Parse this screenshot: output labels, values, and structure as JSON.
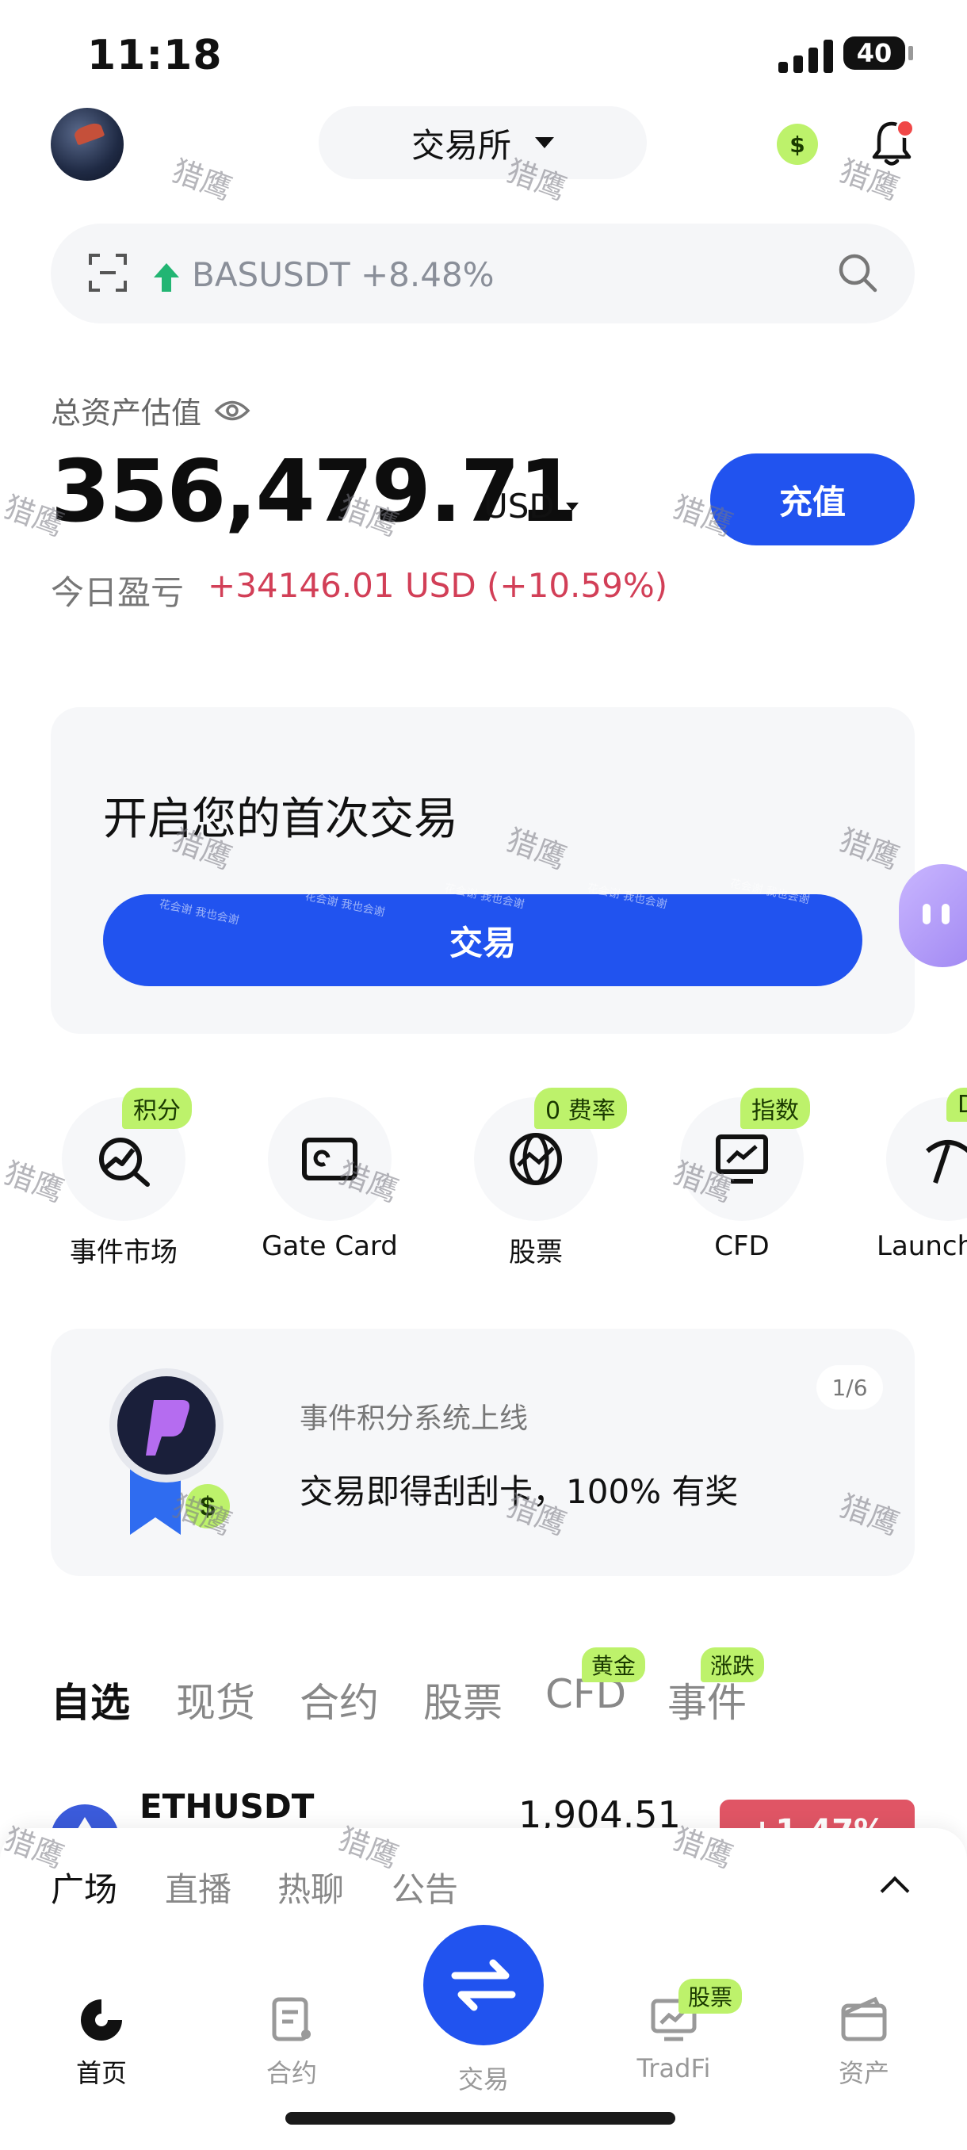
{
  "status_bar": {
    "time": "11:18",
    "battery": "40"
  },
  "header": {
    "exchange_label": "交易所"
  },
  "search": {
    "ticker_text": "BASUSDT +8.48%"
  },
  "balance": {
    "label": "总资产估值",
    "value": "356,479.71",
    "currency": "USD",
    "deposit_label": "充值",
    "pnl_label": "今日盈亏",
    "pnl_value": "+34146.01 USD (+10.59%)"
  },
  "first_trade": {
    "title": "开启您的首次交易",
    "button_label": "交易"
  },
  "shortcuts": [
    {
      "label": "事件市场",
      "badge": "积分",
      "icon": "chart-search-icon"
    },
    {
      "label": "Gate Card",
      "badge": "",
      "icon": "card-icon"
    },
    {
      "label": "股票",
      "badge": "0 费率",
      "icon": "globe-icon"
    },
    {
      "label": "CFD",
      "badge": "指数",
      "icon": "monitor-chart-icon"
    },
    {
      "label": "Launch",
      "badge": "D",
      "icon": "pickaxe-icon"
    }
  ],
  "promo": {
    "subtitle": "事件积分系统上线",
    "title": "交易即得刮刮卡，100% 有奖",
    "page": "1/6"
  },
  "market_tabs": [
    {
      "label": "自选",
      "active": true,
      "badge": ""
    },
    {
      "label": "现货",
      "active": false,
      "badge": ""
    },
    {
      "label": "合约",
      "active": false,
      "badge": ""
    },
    {
      "label": "股票",
      "active": false,
      "badge": ""
    },
    {
      "label": "CFD",
      "active": false,
      "badge": "黄金"
    },
    {
      "label": "事件",
      "active": false,
      "badge": "涨跌"
    }
  ],
  "market_row": {
    "symbol": "ETHUSDT",
    "price": "1,904.51",
    "change": "+1.47%"
  },
  "sheet_tabs": [
    {
      "label": "广场",
      "active": true
    },
    {
      "label": "直播",
      "active": false
    },
    {
      "label": "热聊",
      "active": false
    },
    {
      "label": "公告",
      "active": false
    }
  ],
  "bottom_nav": {
    "home": "首页",
    "futures": "合约",
    "trade": "交易",
    "tradfi": "TradFi",
    "tradfi_badge": "股票",
    "assets": "资产"
  },
  "watermark": {
    "text": "猎鹰",
    "small_text": "花会谢 我也会谢"
  },
  "colors": {
    "accent": "#2153ef",
    "badge": "#bdf26b",
    "negative": "#d23f57",
    "up": "#22b573"
  }
}
